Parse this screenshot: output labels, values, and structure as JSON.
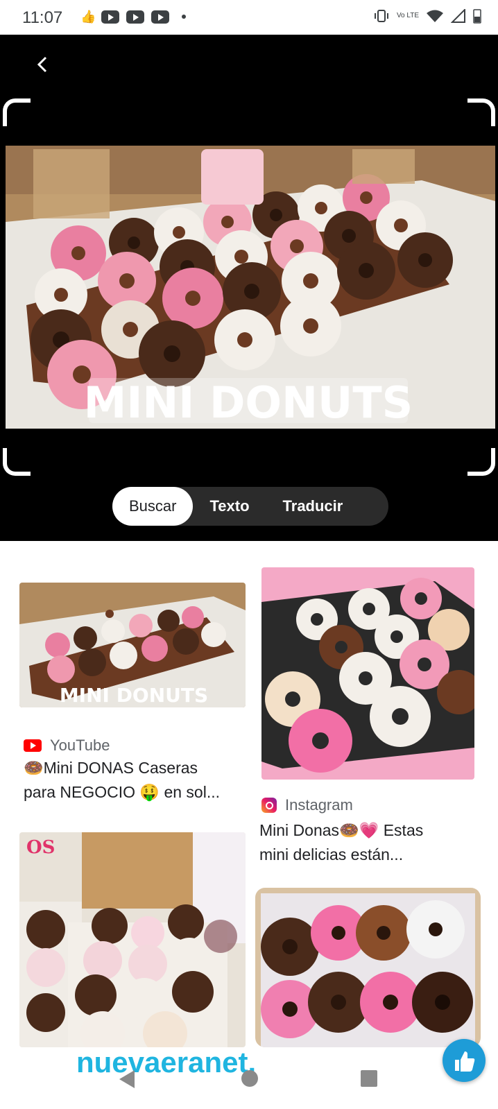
{
  "status_bar": {
    "time": "11:07",
    "network": "Vo LTE"
  },
  "viewer": {
    "image_overlay_text": "MINI DONUTS",
    "tabs": [
      {
        "label": "Buscar",
        "active": true
      },
      {
        "label": "Texto",
        "active": false
      },
      {
        "label": "Traducir",
        "active": false
      }
    ]
  },
  "results": [
    {
      "source": "YouTube",
      "title_line1": "🍩Mini DONAS Caseras",
      "title_line2": "para NEGOCIO 🤑 en sol...",
      "image_text": "MINI DONUTS"
    },
    {
      "source": "Instagram",
      "title_line1": "Mini Donas🍩💗 Estas",
      "title_line2": "mini delicias están..."
    }
  ],
  "watermark": "nuevaeranet.",
  "colors": {
    "accent": "#1fb5e0",
    "youtube": "#ff0000",
    "background_dark": "#000000"
  },
  "icons": {
    "back": "chevron-left-icon",
    "fab": "thumbs-up-icon"
  }
}
